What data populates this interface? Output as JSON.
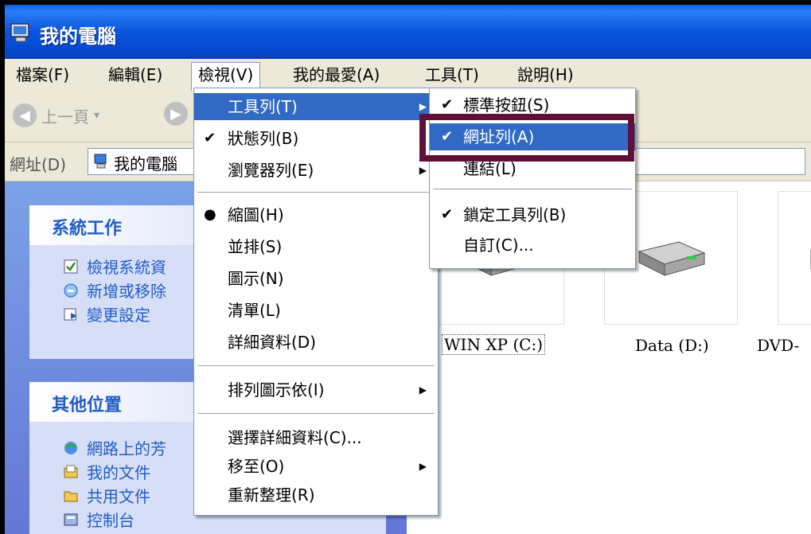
{
  "window": {
    "title": "我的電腦",
    "title_icon": "computer-icon"
  },
  "menubar": {
    "items": [
      {
        "label": "檔案(F)"
      },
      {
        "label": "編輯(E)"
      },
      {
        "label": "檢視(V)"
      },
      {
        "label": "我的最愛(A)"
      },
      {
        "label": "工具(T)"
      },
      {
        "label": "說明(H)"
      }
    ]
  },
  "toolbar": {
    "back_label": "上一頁",
    "back_icon": "back-arrow-icon",
    "forward_icon": "forward-arrow-icon"
  },
  "address": {
    "label": "網址(D)",
    "value": "我的電腦",
    "icon": "computer-icon"
  },
  "left_panels": {
    "system": {
      "title": "系統工作",
      "tasks": [
        {
          "label": "檢視系統資",
          "icon": "view-system-icon"
        },
        {
          "label": "新增或移除",
          "icon": "add-remove-icon"
        },
        {
          "label": "變更設定",
          "icon": "change-settings-icon"
        }
      ]
    },
    "other": {
      "title": "其他位置",
      "tasks": [
        {
          "label": "網路上的芳",
          "icon": "network-icon"
        },
        {
          "label": "我的文件",
          "icon": "my-documents-icon"
        },
        {
          "label": "共用文件",
          "icon": "shared-folder-icon"
        },
        {
          "label": "控制台",
          "icon": "control-panel-icon"
        }
      ]
    }
  },
  "drives": [
    {
      "label": "WIN XP (C:)",
      "icon": "hard-drive-icon"
    },
    {
      "label": "Data (D:)",
      "icon": "hard-drive-icon"
    },
    {
      "label": "DVD-",
      "icon": "dvd-drive-icon"
    }
  ],
  "view_menu": {
    "items": [
      {
        "label": "工具列(T)",
        "check": "",
        "submenu": true
      },
      {
        "label": "狀態列(B)",
        "check": "✔",
        "submenu": false
      },
      {
        "label": "瀏覽器列(E)",
        "check": "",
        "submenu": true
      },
      {
        "label": "縮圖(H)",
        "check": "●",
        "submenu": false
      },
      {
        "label": "並排(S)",
        "check": "",
        "submenu": false
      },
      {
        "label": "圖示(N)",
        "check": "",
        "submenu": false
      },
      {
        "label": "清單(L)",
        "check": "",
        "submenu": false
      },
      {
        "label": "詳細資料(D)",
        "check": "",
        "submenu": false
      },
      {
        "label": "排列圖示依(I)",
        "check": "",
        "submenu": true
      },
      {
        "label": "選擇詳細資料(C)...",
        "check": "",
        "submenu": false
      },
      {
        "label": "移至(O)",
        "check": "",
        "submenu": true
      },
      {
        "label": "重新整理(R)",
        "check": "",
        "submenu": false
      }
    ]
  },
  "toolbar_submenu": {
    "items": [
      {
        "label": "標準按鈕(S)",
        "check": "✔"
      },
      {
        "label": "網址列(A)",
        "check": "✔"
      },
      {
        "label": "連結(L)",
        "check": ""
      },
      {
        "label": "鎖定工具列(B)",
        "check": "✔"
      },
      {
        "label": "自訂(C)...",
        "check": ""
      }
    ]
  },
  "colors": {
    "titlebar": "#0a56de",
    "menu_highlight": "#316ac5",
    "callout_border": "#5e1036",
    "task_link": "#215dc6"
  }
}
